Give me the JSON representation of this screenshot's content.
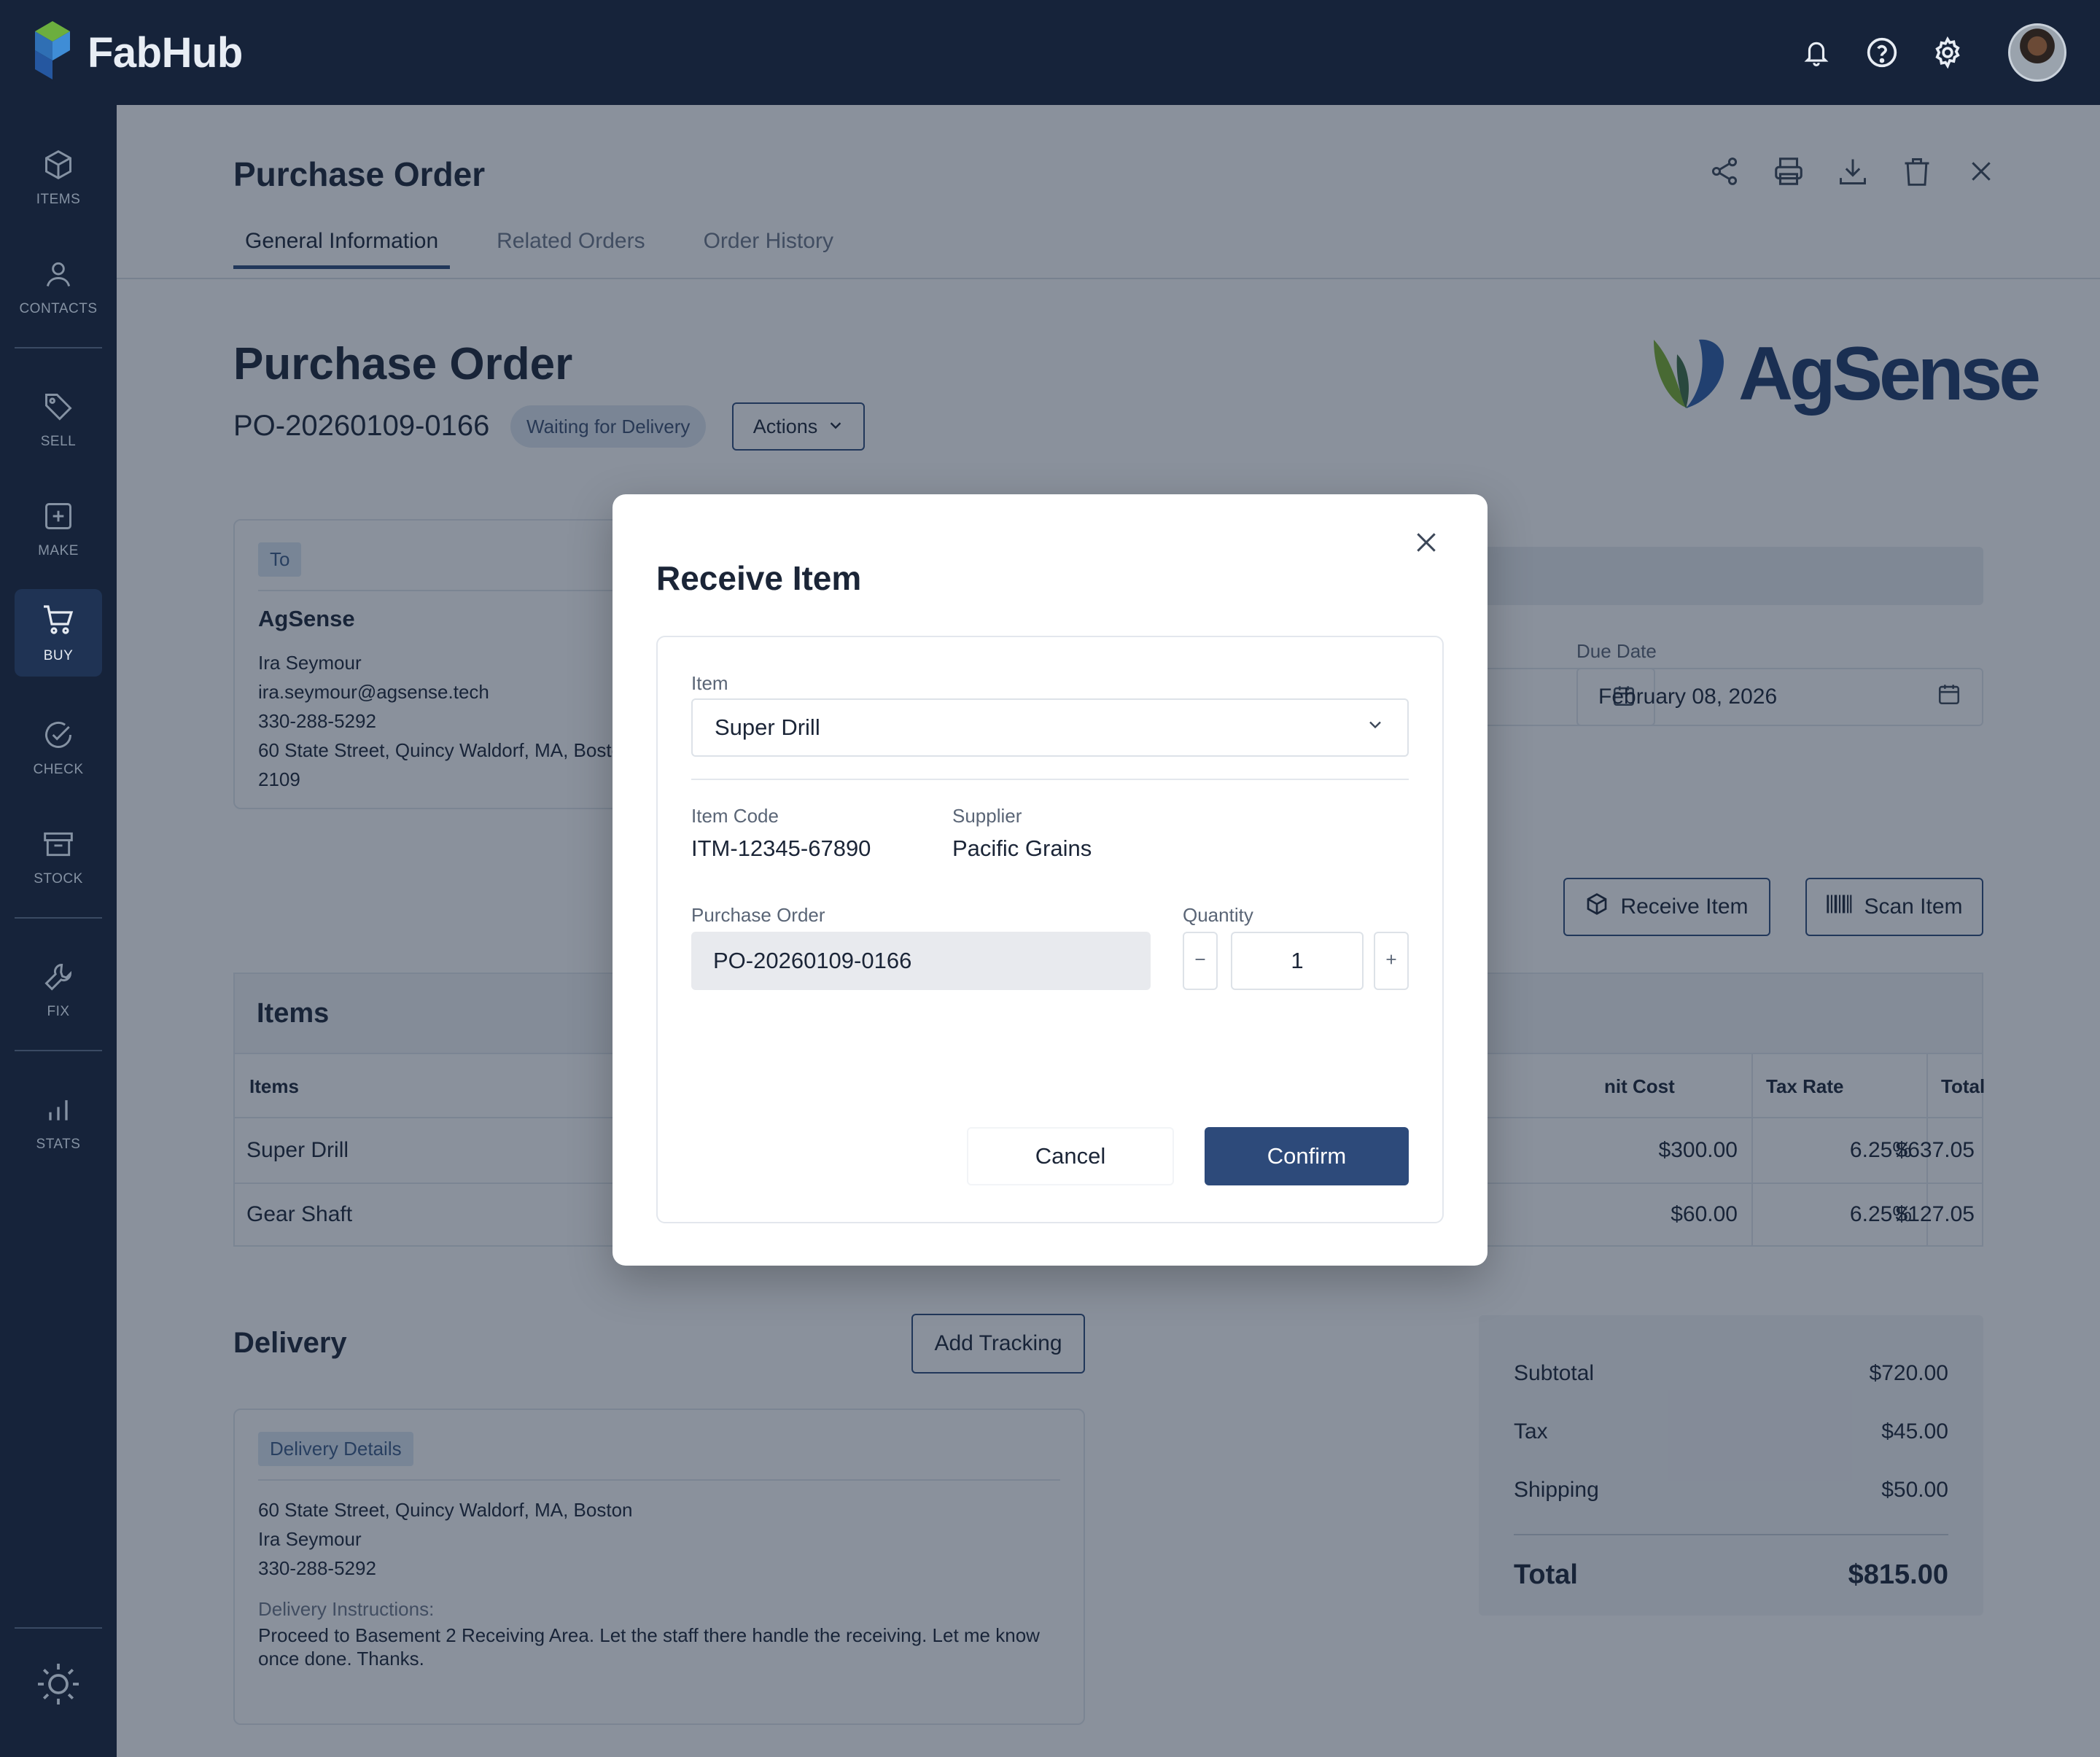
{
  "app": {
    "name": "FabHub"
  },
  "sidebar": {
    "items": [
      {
        "label": "ITEMS",
        "icon": "cube-icon"
      },
      {
        "label": "CONTACTS",
        "icon": "user-icon"
      },
      {
        "label": "SELL",
        "icon": "tag-icon"
      },
      {
        "label": "MAKE",
        "icon": "plus-square-icon"
      },
      {
        "label": "BUY",
        "icon": "cart-icon",
        "active": true
      },
      {
        "label": "CHECK",
        "icon": "check-circle-icon"
      },
      {
        "label": "STOCK",
        "icon": "archive-icon"
      },
      {
        "label": "FIX",
        "icon": "wrench-icon"
      },
      {
        "label": "STATS",
        "icon": "bar-chart-icon"
      }
    ]
  },
  "page": {
    "header_title": "Purchase Order",
    "tabs": [
      {
        "label": "General Information",
        "active": true
      },
      {
        "label": "Related Orders"
      },
      {
        "label": "Order History"
      }
    ],
    "doc_title": "Purchase Order",
    "po_number": "PO-20260109-0166",
    "status": "Waiting for Delivery",
    "actions_label": "Actions",
    "logo_text": "AgSense"
  },
  "to_card": {
    "tag": "To",
    "company": "AgSense",
    "contact": "Ira Seymour",
    "email": "ira.seymour@agsense.tech",
    "phone": "330-288-5292",
    "address_line1": "60 State Street, Quincy Waldorf, MA, Boston",
    "address_line2": "2109"
  },
  "dates": {
    "due_label": "Due Date",
    "due_value": "February 08, 2026"
  },
  "buttons": {
    "receive_item": "Receive Item",
    "scan_item": "Scan Item",
    "add_tracking": "Add Tracking"
  },
  "items_table": {
    "title": "Items",
    "columns": [
      "Items",
      "nit Cost",
      "Tax Rate",
      "Total"
    ],
    "rows": [
      {
        "item": "Super Drill",
        "unit_cost": "$300.00",
        "tax_rate": "6.25%",
        "total": "$637.05"
      },
      {
        "item": "Gear Shaft",
        "unit_cost": "$60.00",
        "tax_rate": "6.25%",
        "total": "$127.05"
      }
    ]
  },
  "delivery": {
    "title": "Delivery",
    "tag": "Delivery Details",
    "address": "60 State Street, Quincy Waldorf, MA, Boston",
    "contact": "Ira Seymour",
    "phone": "330-288-5292",
    "instructions_label": "Delivery Instructions:",
    "instructions": "Proceed to Basement 2 Receiving Area. Let the staff there handle the receiving. Let me know once done. Thanks."
  },
  "totals": {
    "subtotal_label": "Subtotal",
    "subtotal": "$720.00",
    "tax_label": "Tax",
    "tax": "$45.00",
    "shipping_label": "Shipping",
    "shipping": "$50.00",
    "total_label": "Total",
    "total": "$815.00"
  },
  "modal": {
    "title": "Receive Item",
    "item_label": "Item",
    "item_value": "Super Drill",
    "item_code_label": "Item Code",
    "item_code": "ITM-12345-67890",
    "supplier_label": "Supplier",
    "supplier": "Pacific Grains",
    "po_label": "Purchase Order",
    "po_value": "PO-20260109-0166",
    "quantity_label": "Quantity",
    "quantity": "1",
    "cancel": "Cancel",
    "confirm": "Confirm"
  },
  "colors": {
    "navy": "#16233a",
    "accent": "#2d4a7a",
    "overlay": "rgba(22,35,58,0.5)"
  }
}
